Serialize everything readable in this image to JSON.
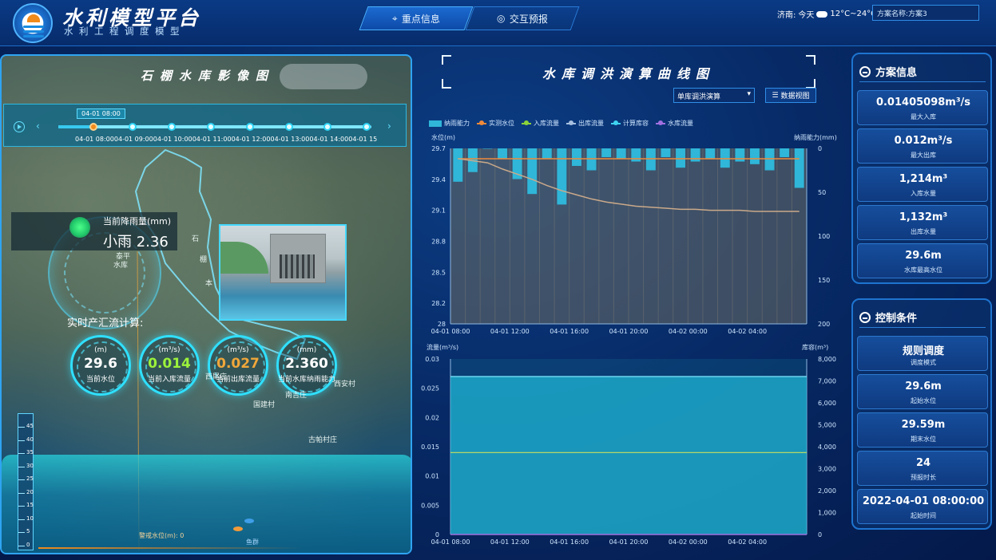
{
  "header": {
    "title": "水利模型平台",
    "subtitle": "水利工程调度模型",
    "tabs": [
      {
        "label": "重点信息",
        "active": true
      },
      {
        "label": "交互预报",
        "active": false
      }
    ],
    "weather": {
      "city": "济南:",
      "day": "今天",
      "temp": "12°C~24°C"
    },
    "plan_select": "方案名称:方案3"
  },
  "left": {
    "title": "石棚水库影像图",
    "timeline": {
      "tooltip": "04-01 08:00",
      "labels": [
        "04-01 08:00",
        "04-01 09:00",
        "04-01 10:00",
        "04-01 11:00",
        "04-01 12:00",
        "04-01 13:00",
        "04-01 14:00",
        "04-01 15"
      ],
      "current_index": 0
    },
    "rain": {
      "label": "当前降雨量(mm)",
      "value": "小雨 2.36"
    },
    "map_labels": [
      "石",
      "棚",
      "本",
      "泰平",
      "水库"
    ],
    "realtime_title": "实时产汇流计算:",
    "gauges": [
      {
        "unit": "(m)",
        "value": "29.6",
        "name": "当前水位",
        "color": "#ffffff"
      },
      {
        "unit": "(m³/s)",
        "value": "0.014",
        "name": "当前入库流量",
        "color": "#9cf23b"
      },
      {
        "unit": "(m³/s)",
        "value": "0.027",
        "name": "当前出库流量",
        "color": "#f0a73a"
      },
      {
        "unit": "(mm)",
        "value": "2.360",
        "name": "当前水库纳雨能力",
        "color": "#ffffff"
      }
    ],
    "village_labels": [
      "国建村",
      "西安村",
      "南吉庄",
      "古帕村庄",
      "西尾庄"
    ],
    "ruler_ticks": [
      "45",
      "40",
      "35",
      "30",
      "25",
      "20",
      "15",
      "10",
      "5",
      "0"
    ],
    "bottom_label": "警戒水位(m): 0",
    "bottom_label2": "鱼群"
  },
  "middle": {
    "title": "水库调洪演算曲线图",
    "select": "单库调洪演算",
    "data_view_button": "数据视图",
    "legend": [
      {
        "name": "纳雨能力",
        "color": "#2fb6d8",
        "kind": "bar"
      },
      {
        "name": "实测水位",
        "color": "#f08a3a",
        "kind": "line"
      },
      {
        "name": "入库流量",
        "color": "#8ad23a",
        "kind": "line"
      },
      {
        "name": "出库流量",
        "color": "#a8c0e0",
        "kind": "line"
      },
      {
        "name": "计算库容",
        "color": "#3fd3f0",
        "kind": "line"
      },
      {
        "name": "水库流量",
        "color": "#a070e0",
        "kind": "line"
      }
    ]
  },
  "chart_data": [
    {
      "type": "bar",
      "title": "",
      "ylabel": "水位(m)",
      "y2label": "纳雨能力(mm)",
      "yticks": [
        "29.7",
        "29.4",
        "29.1",
        "28.8",
        "28.5",
        "28.2",
        "28"
      ],
      "y2ticks": [
        "0",
        "50",
        "100",
        "150",
        "200"
      ],
      "xticks": [
        "04-01 08:00",
        "04-01 12:00",
        "04-01 16:00",
        "04-01 20:00",
        "04-02 00:00",
        "04-02 04:00"
      ],
      "ylim": [
        28,
        29.7
      ],
      "y2lim": [
        0,
        200
      ],
      "x": [
        "04-01 08:00",
        "04-01 09:00",
        "04-01 10:00",
        "04-01 11:00",
        "04-01 12:00",
        "04-01 13:00",
        "04-01 14:00",
        "04-01 15:00",
        "04-01 16:00",
        "04-01 17:00",
        "04-01 18:00",
        "04-01 19:00",
        "04-01 20:00",
        "04-01 21:00",
        "04-01 22:00",
        "04-01 23:00",
        "04-02 00:00",
        "04-02 01:00",
        "04-02 02:00",
        "04-02 03:00",
        "04-02 04:00",
        "04-02 05:00",
        "04-02 06:00",
        "04-02 07:00"
      ],
      "series": [
        {
          "name": "纳雨能力",
          "axis": "right",
          "values": [
            38,
            27,
            0,
            12,
            35,
            52,
            12,
            64,
            20,
            25,
            10,
            12,
            15,
            25,
            10,
            22,
            15,
            12,
            22,
            15,
            18,
            25,
            10,
            45
          ]
        },
        {
          "name": "实测水位",
          "axis": "left",
          "values": [
            29.6,
            29.6,
            29.6,
            29.6,
            29.6,
            29.6,
            29.6,
            29.6,
            29.6,
            29.6,
            29.6,
            29.6,
            29.6,
            29.6,
            29.6,
            29.6,
            29.6,
            29.6,
            29.6,
            29.6,
            29.6,
            29.6,
            29.6,
            29.6
          ]
        },
        {
          "name": "计算库容",
          "axis": "left",
          "values": [
            29.6,
            29.58,
            29.56,
            29.5,
            29.45,
            29.4,
            29.34,
            29.29,
            29.25,
            29.21,
            29.18,
            29.16,
            29.14,
            29.13,
            29.12,
            29.11,
            29.11,
            29.1,
            29.1,
            29.1,
            29.09,
            29.09,
            29.09,
            29.09
          ]
        }
      ]
    },
    {
      "type": "area",
      "title": "",
      "ylabel": "流量(m³/s)",
      "y2label": "库容(m³)",
      "yticks": [
        "0.03",
        "0.025",
        "0.02",
        "0.015",
        "0.01",
        "0.005",
        "0"
      ],
      "y2ticks": [
        "8,000",
        "7,000",
        "6,000",
        "5,000",
        "4,000",
        "3,000",
        "2,000",
        "1,000",
        "0"
      ],
      "xticks": [
        "04-01 08:00",
        "04-01 12:00",
        "04-01 16:00",
        "04-01 20:00",
        "04-02 00:00",
        "04-02 04:00"
      ],
      "ylim": [
        0,
        0.03
      ],
      "y2lim": [
        0,
        8000
      ],
      "series": [
        {
          "name": "出库流量",
          "axis": "left",
          "value": 0.027
        },
        {
          "name": "入库流量",
          "axis": "left",
          "value": 0.014
        },
        {
          "name": "水库流量",
          "axis": "left",
          "value": 0
        }
      ]
    }
  ],
  "right": {
    "plan_info": {
      "title": "方案信息",
      "cards": [
        {
          "value": "0.01405098m³/s",
          "label": "最大入库"
        },
        {
          "value": "0.012m³/s",
          "label": "最大出库"
        },
        {
          "value": "1,214m³",
          "label": "入库水量"
        },
        {
          "value": "1,132m³",
          "label": "出库水量"
        },
        {
          "value": "29.6m",
          "label": "水库最高水位"
        }
      ]
    },
    "control": {
      "title": "控制条件",
      "cards": [
        {
          "value": "规则调度",
          "label": "调度模式"
        },
        {
          "value": "29.6m",
          "label": "起始水位"
        },
        {
          "value": "29.59m",
          "label": "期末水位"
        },
        {
          "value": "24",
          "label": "预报时长"
        },
        {
          "value": "2022-04-01 08:00:00",
          "label": "起始时间"
        }
      ]
    }
  }
}
